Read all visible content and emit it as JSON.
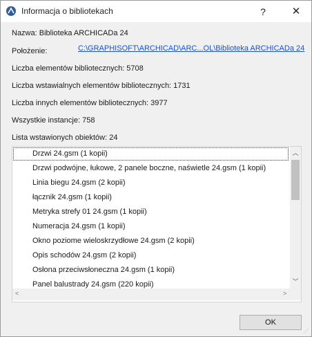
{
  "window": {
    "title": "Informacja o bibliotekach",
    "help_label": "?",
    "close_label": "✕"
  },
  "info": {
    "name_label": "Nazwa: Biblioteka ARCHICADa 24",
    "location_label": "Położenie:",
    "location_path": "C:\\GRAPHISOFT\\ARCHICAD\\ARC...OL\\Biblioteka ARCHICADa 24",
    "total_elements": "Liczba elementów bibliotecznych: 5708",
    "insertable_elements": "Liczba wstawialnych elementów bibliotecznych: 1731",
    "other_elements": "Liczba innych elementów bibliotecznych: 3977",
    "all_instances": "Wszystkie instancje: 758",
    "inserted_list_label": "Lista wstawionych obiektów: 24"
  },
  "list": {
    "items": [
      "Drzwi 24.gsm (1 kopii)",
      "Drzwi podwójne, łukowe, 2 panele boczne, naświetle 24.gsm (1 kopii)",
      "Linia biegu 24.gsm (2 kopii)",
      "łącznik 24.gsm (1 kopii)",
      "Metryka strefy 01 24.gsm (1 kopii)",
      "Numeracja 24.gsm (1 kopii)",
      "Okno poziome wieloskrzydłowe 24.gsm (2 kopii)",
      "Opis schodów 24.gsm (2 kopii)",
      "Osłona przeciwsłoneczna 24.gsm (1 kopii)",
      "Panel balustrady 24.gsm (220 kopii)"
    ],
    "scroll_up": "︿",
    "scroll_down": "﹀",
    "scroll_left": "<",
    "scroll_right": ">"
  },
  "footer": {
    "ok_label": "OK"
  },
  "colors": {
    "link": "#1a4fd8",
    "app_icon": "#2e5e9e"
  }
}
